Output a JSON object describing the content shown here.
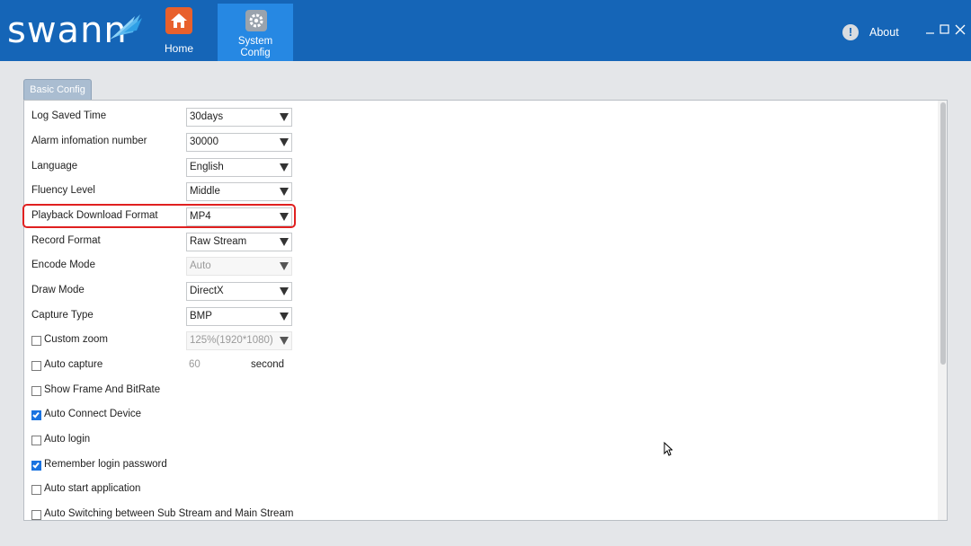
{
  "app": {
    "logo_text": "swann",
    "nav": [
      {
        "label": "Home",
        "icon": "home-icon"
      },
      {
        "label_line1": "System",
        "label_line2": "Config",
        "icon": "gear-icon",
        "active": true
      }
    ],
    "about_label": "About",
    "accent_color": "#1565b7",
    "active_tab_color": "#2688e3"
  },
  "tab": {
    "label": "Basic Config"
  },
  "settings": {
    "log_saved_time": {
      "label": "Log Saved Time",
      "value": "30days"
    },
    "alarm_info_number": {
      "label": "Alarm infomation number",
      "value": "30000"
    },
    "language": {
      "label": "Language",
      "value": "English"
    },
    "fluency_level": {
      "label": "Fluency Level",
      "value": "Middle"
    },
    "playback_download_format": {
      "label": "Playback Download Format",
      "value": "MP4",
      "highlighted": true
    },
    "record_format": {
      "label": "Record Format",
      "value": "Raw Stream"
    },
    "encode_mode": {
      "label": "Encode Mode",
      "value": "Auto",
      "disabled": true
    },
    "draw_mode": {
      "label": "Draw Mode",
      "value": "DirectX"
    },
    "capture_type": {
      "label": "Capture Type",
      "value": "BMP"
    },
    "custom_zoom": {
      "label": "Custom zoom",
      "checked": false,
      "value": "125%(1920*1080)",
      "disabled": true
    },
    "auto_capture": {
      "label": "Auto capture",
      "checked": false,
      "value": "60",
      "unit": "second"
    },
    "show_frame_bitrate": {
      "label": "Show Frame And BitRate",
      "checked": false
    },
    "auto_connect_device": {
      "label": "Auto Connect Device",
      "checked": true
    },
    "auto_login": {
      "label": "Auto login",
      "checked": false
    },
    "remember_login_password": {
      "label": "Remember login password",
      "checked": true
    },
    "auto_start_application": {
      "label": "Auto start application",
      "checked": false
    },
    "auto_switch_stream": {
      "label": "Auto Switching between Sub Stream and Main Stream",
      "checked": false
    }
  }
}
